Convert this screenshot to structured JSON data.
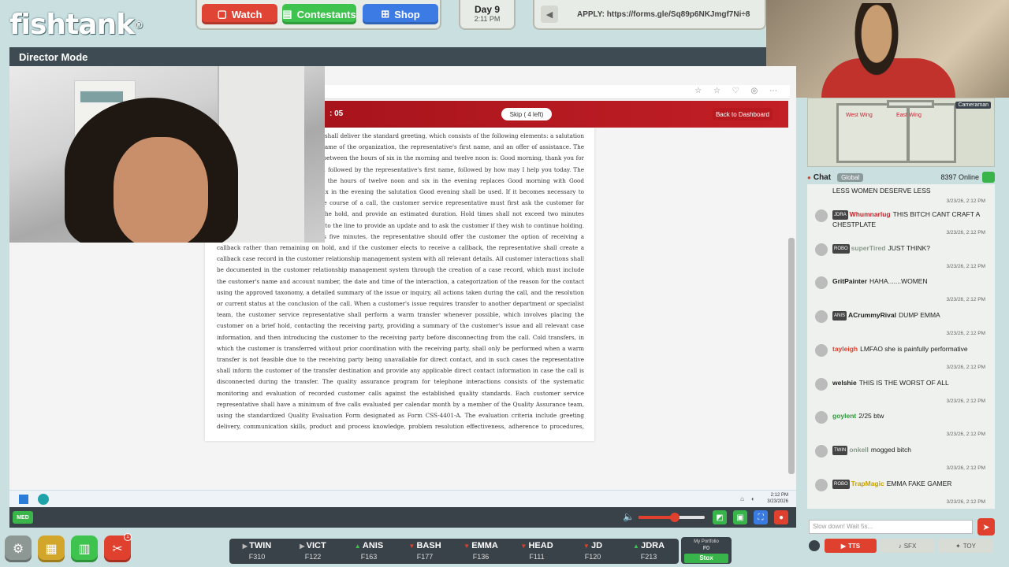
{
  "brand": {
    "logo_text": "fishtank"
  },
  "nav": {
    "watch": "Watch",
    "contestants": "Contestants",
    "shop": "Shop"
  },
  "day": {
    "label": "Day 9",
    "time": "2:11 PM"
  },
  "apply": {
    "text": "APPLY: https://forms.gle/Sq89p6NKJmgf7Ni÷8"
  },
  "director": {
    "title": "Director Mode"
  },
  "quiz": {
    "timer": ": 05",
    "skip_label": "Skip ( 4 left)",
    "back_label": "Back to Dashboard",
    "document_text": "The customer service representative shall deliver the standard greeting, which consists of the following elements: a salutation appropriate to the time of day, the name of the organization, the representative's first name, and an offer of assistance. The standard greeting for calls received between the hours of six in the morning and twelve noon is: Good morning, thank you for calling the organization, my name is, followed by the representative's first name, followed by how may I help you today. The greeting for calls received between the hours of twelve noon and six in the evening replaces Good morning with Good afternoon. For calls received after six in the evening the salutation Good evening shall be used. If it becomes necessary to place a customer on hold during the course of a call, the customer service representative must first ask the customer for permission, explain the reason for the hold, and provide an estimated duration. Hold times shall not exceed two minutes without the representative returning to the line to provide an update and to ask the customer if they wish to continue holding. If the anticipated hold time exceeds five minutes, the representative should offer the customer the option of receiving a callback rather than remaining on hold, and if the customer elects to receive a callback, the representative shall create a callback case record in the customer relationship management system with all relevant details. All customer interactions shall be documented in the customer relationship management system through the creation of a case record, which must include the customer's name and account number, the date and time of the interaction, a categorization of the reason for the contact using the approved taxonomy, a detailed summary of the issue or inquiry, all actions taken during the call, and the resolution or current status at the conclusion of the call. When a customer's issue requires transfer to another department or specialist team, the customer service representative shall perform a warm transfer whenever possible, which involves placing the customer on a brief hold, contacting the receiving party, providing a summary of the customer's issue and all relevant case information, and then introducing the customer to the receiving party before disconnecting from the call. Cold transfers, in which the customer is transferred without prior coordination with the receiving party, shall only be performed when a warm transfer is not feasible due to the receiving party being unavailable for direct contact, and in such cases the representative shall inform the customer of the transfer destination and provide any applicable direct contact information in case the call is disconnected during the transfer. The quality assurance program for telephone interactions consists of the systematic monitoring and evaluation of recorded customer calls against the established quality standards. Each customer service representative shall have a minimum of five calls evaluated per calendar month by a member of the Quality Assurance team, using the standardized Quality Evaluation Form designated as Form CSS-4401-A. The evaluation criteria include greeting delivery, communication skills, product and process knowledge, problem resolution effectiveness, adherence to procedures, and professionalism. Representatives who receive an evaluation score below the acceptable threshold of eighty-five percent on any individual evaluation shall receive targeted coaching from their supervisor within five business days of the evaluation."
  },
  "taskbar": {
    "clock_time": "2:12 PM",
    "clock_date": "3/23/2026"
  },
  "stream": {
    "quality_badge": "MED",
    "volume_fraction": 0.55
  },
  "map": {
    "labels": [
      "West Wing",
      "East Wing"
    ],
    "cameraman_label": "Cameraman"
  },
  "chat": {
    "title": "Chat",
    "scope_badge": "Global",
    "online_count": "8397 Online",
    "input_placeholder": "Slow down! Wait 5s...",
    "first_line": "LESS WOMEN DESERVE LESS",
    "messages": [
      {
        "badge": "JDRA",
        "user": "Whumnarlug",
        "user_color": "#c1272d",
        "text": "THIS BITCH CANT CRAFT A CHESTPLATE",
        "time": "3/23/26, 2:12 PM"
      },
      {
        "badge": "ROBO",
        "user": "superTired",
        "user_color": "#8a9a8a",
        "text": "JUST THINK?",
        "time": "3/23/26, 2:12 PM"
      },
      {
        "badge": "",
        "user": "GritPainter",
        "user_color": "#222222",
        "text": "HAHA.......WOMEN",
        "time": "3/23/26, 2:12 PM"
      },
      {
        "badge": "ANIS",
        "user": "ACrummyRival",
        "user_color": "#222222",
        "text": "DUMP EMMA",
        "time": "3/23/26, 2:12 PM"
      },
      {
        "badge": "",
        "user": "tayleigh",
        "user_color": "#e0402e",
        "text": "LMFAO she is painfully performative",
        "time": "3/23/26, 2:12 PM"
      },
      {
        "badge": "",
        "user": "welshie",
        "user_color": "#222222",
        "text": "THIS IS THE WORST OF ALL",
        "time": "3/23/26, 2:12 PM"
      },
      {
        "badge": "",
        "user": "goylent",
        "user_color": "#2e9a3a",
        "text": "2/25 btw",
        "time": "3/23/26, 2:12 PM"
      },
      {
        "badge": "TWIN",
        "user": "onkell",
        "user_color": "#8a9a8a",
        "text": "mogged bitch",
        "time": "3/23/26, 2:12 PM"
      },
      {
        "badge": "ROBO",
        "user": "TrapMagic",
        "user_color": "#c9a200",
        "text": "EMMA FAKE GAMER",
        "time": "3/23/26, 2:12 PM"
      }
    ],
    "tts_label": "TTS",
    "sfx_label": "SFX",
    "toy_label": "TOY"
  },
  "dock": {
    "notification_count": "1"
  },
  "ticker": [
    {
      "name": "TWIN",
      "trend": "side",
      "price": "F310"
    },
    {
      "name": "VICT",
      "trend": "side",
      "price": "F122"
    },
    {
      "name": "ANIS",
      "trend": "up",
      "price": "F163"
    },
    {
      "name": "BASH",
      "trend": "down",
      "price": "F177"
    },
    {
      "name": "EMMA",
      "trend": "down",
      "price": "F136"
    },
    {
      "name": "HEAD",
      "trend": "down",
      "price": "F111"
    },
    {
      "name": "JD",
      "trend": "down",
      "price": "F120"
    },
    {
      "name": "JDRA",
      "trend": "up",
      "price": "F213"
    }
  ],
  "portfolio": {
    "label": "My Portfolio",
    "value": "F0",
    "button": "Stox"
  },
  "colors": {
    "accent_red": "#e0402e",
    "accent_green": "#3ec34e",
    "accent_blue": "#3c7be3",
    "panel_bg": "#c9dfe0"
  }
}
